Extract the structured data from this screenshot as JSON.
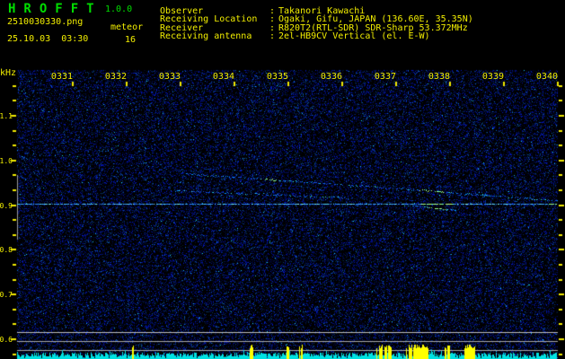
{
  "header": {
    "app_title": "HROFFT",
    "app_version": "1.0.0",
    "filename": "2510030330.png",
    "mode": "meteor",
    "datetime": "25.10.03  03:30",
    "echo_count": "16",
    "separator": ":",
    "info_rows": [
      {
        "label": "Observer",
        "value": "Takanori Kawachi"
      },
      {
        "label": "Receiving Location",
        "value": "Ogaki, Gifu, JAPAN (136.60E, 35.35N)"
      },
      {
        "label": "Receiver",
        "value": "R820T2(RTL-SDR) SDR-Sharp 53.372MHz"
      },
      {
        "label": "Receiving antenna",
        "value": "2el-HB9CV Vertical (el. E-W)"
      }
    ]
  },
  "colors": {
    "background": "#000000",
    "title_green": "#00dd00",
    "text_yellow": "#f2ee00",
    "tick_yellow": "#f0e800",
    "noise_blue": "#2040ff",
    "trace_cyan": "#50c8ff",
    "trace_bright": "#90ffb0",
    "gray_line": "#a8a8a8",
    "bar_cyan": "#00e2e2",
    "bar_yellow": "#ffff00"
  },
  "chart_data": {
    "type": "heatmap",
    "subtype": "radio-meteor-spectrogram",
    "title": "HROFFT 10-minute meteor echo spectrogram 0330-0340",
    "ylabel": "kHz",
    "x_ticks": [
      "0331",
      "0332",
      "0333",
      "0334",
      "0335",
      "0336",
      "0337",
      "0338",
      "0339",
      "0340"
    ],
    "x_tick_minutes": [
      1,
      2,
      3,
      4,
      5,
      6,
      7,
      8,
      9,
      10
    ],
    "xlim_minutes_after_0330": [
      0,
      10.15
    ],
    "y_tick_labels": [
      "1.1",
      "1.0",
      "0.9",
      "0.8",
      "0.7",
      "0.6"
    ],
    "y_tick_values": [
      1.1,
      1.0,
      0.9,
      0.8,
      0.7,
      0.6
    ],
    "ylim_khz": [
      0.554,
      1.2
    ],
    "grid": false,
    "carrier_khz": 0.901,
    "traces": [
      {
        "name": "carrier-line",
        "points_min_khz": [
          [
            -0.02,
            0.901
          ],
          [
            10.15,
            0.901
          ]
        ],
        "density": "solid",
        "bright_segments_min": [
          [
            7.47,
            8.05
          ],
          [
            9.83,
            10.08
          ]
        ]
      },
      {
        "name": "doppler-trace-1",
        "points_min_khz": [
          [
            3.08,
            0.969
          ],
          [
            7.12,
            0.935
          ],
          [
            10.15,
            0.907
          ]
        ],
        "density": "dotted",
        "bright_segments_min": [
          [
            4.45,
            4.85
          ],
          [
            7.45,
            7.9
          ]
        ]
      },
      {
        "name": "doppler-trace-2",
        "points_min_khz": [
          [
            2.83,
            0.931
          ],
          [
            6.08,
            0.915
          ]
        ],
        "density": "dotted",
        "bright_segments_min": []
      },
      {
        "name": "doppler-trace-3",
        "points_min_khz": [
          [
            7.17,
            0.899
          ],
          [
            8.12,
            0.887
          ]
        ],
        "density": "dotted",
        "bright_segments_min": [
          [
            7.6,
            7.95
          ]
        ]
      }
    ],
    "count_range_marker_khz": [
      0.82,
      0.965
    ],
    "amplitude_ref_lines_khz": [
      0.614,
      0.594,
      0.574
    ],
    "echo_markers_min": [
      [
        2.1,
        2.17
      ],
      [
        4.28,
        4.35
      ],
      [
        4.98,
        5.02
      ],
      [
        5.2,
        5.28
      ],
      [
        6.65,
        6.93
      ],
      [
        7.2,
        7.6
      ],
      [
        7.9,
        8.0
      ],
      [
        8.27,
        8.48
      ]
    ]
  }
}
